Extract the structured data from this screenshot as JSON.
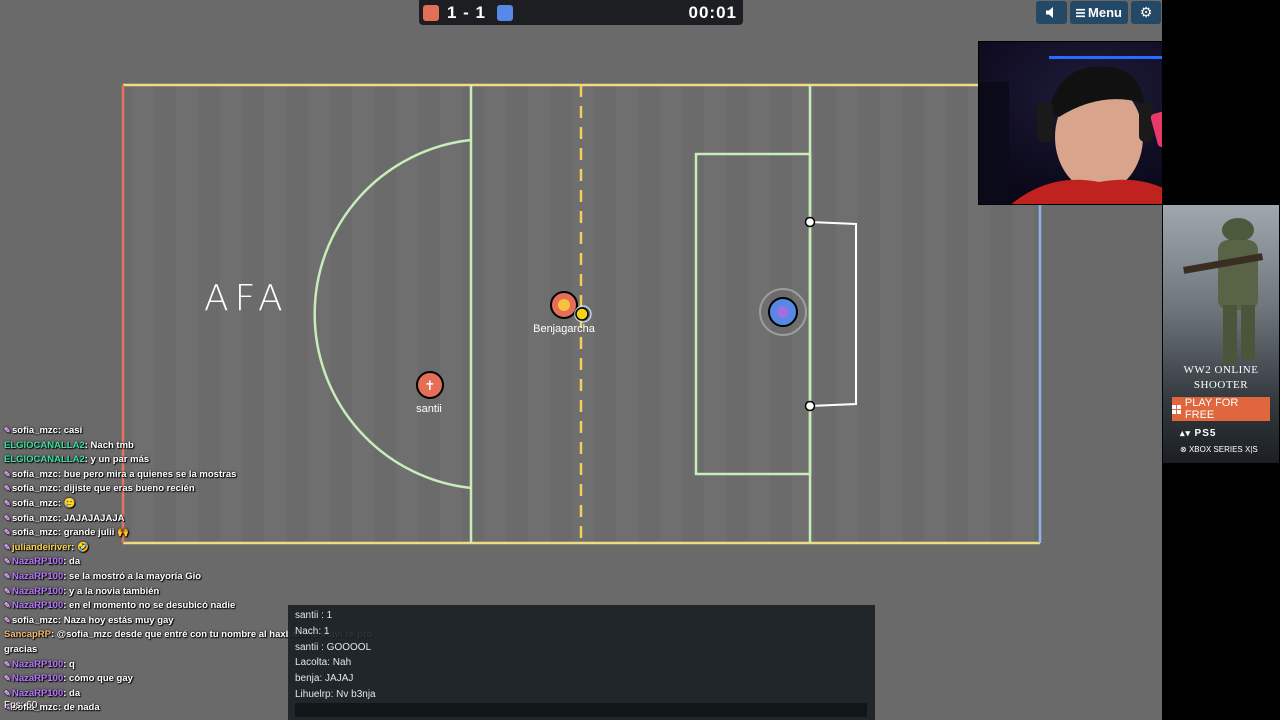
{
  "scoreboard": {
    "score": "1 - 1",
    "timer": "00:01",
    "red_team_color": "#e56e56",
    "blue_team_color": "#5689e5"
  },
  "top_buttons": {
    "sound_icon": "speaker-icon",
    "menu_label": "Menu",
    "menu_icon": "hamburger-icon",
    "settings_icon": "gear-icon"
  },
  "field": {
    "logo_text": "AFA",
    "players": [
      {
        "name": "Benjagarcha",
        "team": "red",
        "avatar": "emoji-face"
      },
      {
        "name": "santii",
        "team": "red",
        "avatar": "✝"
      },
      {
        "name": "",
        "team": "blue",
        "avatar": "hand-icon"
      }
    ]
  },
  "twitch_chat": [
    {
      "user": "sofia_mzc",
      "color": "#ffffff",
      "msg": "casi"
    },
    {
      "user": "ELGIOCANALLA2",
      "color": "#3ce0a0",
      "msg": "Nach tmb"
    },
    {
      "user": "ELGIOCANALLA2",
      "color": "#3ce0a0",
      "msg": "y un par más"
    },
    {
      "user": "sofia_mzc",
      "color": "#ffffff",
      "msg": "bue pero mira a quienes se la mostras"
    },
    {
      "user": "sofia_mzc",
      "color": "#ffffff",
      "msg": "dijiste que eras bueno recién"
    },
    {
      "user": "sofia_mzc",
      "color": "#ffffff",
      "msg": "🥲"
    },
    {
      "user": "sofia_mzc",
      "color": "#ffffff",
      "msg": "JAJAJAJAJA"
    },
    {
      "user": "sofia_mzc",
      "color": "#ffffff",
      "msg": "grande julii 🙌"
    },
    {
      "user": "juliandeiriver",
      "color": "#ffd54a",
      "msg": "🤣"
    },
    {
      "user": "NazaRP100",
      "color": "#b777ff",
      "msg": "da"
    },
    {
      "user": "NazaRP100",
      "color": "#b777ff",
      "msg": "se la mostró a la mayoría Gio"
    },
    {
      "user": "NazaRP100",
      "color": "#b777ff",
      "msg": "y a la novia también"
    },
    {
      "user": "NazaRP100",
      "color": "#b777ff",
      "msg": "en el momento no se desubicó nadie"
    },
    {
      "user": "sofia_mzc",
      "color": "#ffffff",
      "msg": "Naza hoy estás muy gay"
    },
    {
      "user": "SancapRP",
      "color": "#f3b96b",
      "msg": "@sofia_mzc desde que entré con tu nombre al haxball me volvi re pro gracias"
    },
    {
      "user": "NazaRP100",
      "color": "#b777ff",
      "msg": "q"
    },
    {
      "user": "NazaRP100",
      "color": "#b777ff",
      "msg": "cómo que gay"
    },
    {
      "user": "NazaRP100",
      "color": "#b777ff",
      "msg": "da"
    },
    {
      "user": "sofia_mzc",
      "color": "#ffffff",
      "msg": "de nada"
    }
  ],
  "game_chat": [
    "santii : 1",
    "Nach: 1",
    "santii : GOOOOL",
    "Lacolta: Nah",
    "benja: JAJAJ",
    "Lihuelrp: Nv b3nja"
  ],
  "fps_label": "Fps: 60",
  "ad": {
    "title_line1": "WW2 ONLINE",
    "title_line2": "SHOOTER",
    "cta": "PLAY FOR FREE",
    "platform1": "PS5",
    "platform2": "XBOX SERIES X|S"
  }
}
